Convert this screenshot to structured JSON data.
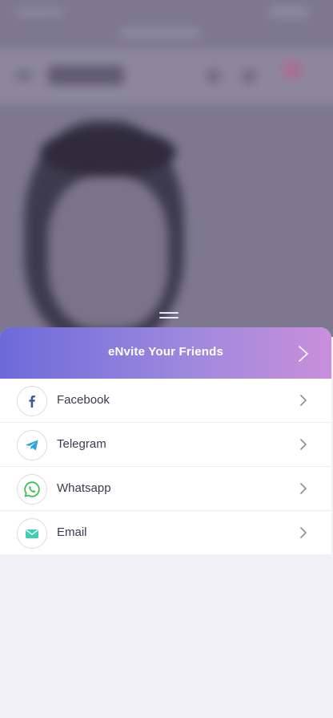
{
  "sheet": {
    "title": "eNvite Your Friends",
    "items": [
      {
        "label": "Facebook",
        "icon": "facebook-icon",
        "color": "#3b5998"
      },
      {
        "label": "Telegram",
        "icon": "telegram-icon",
        "color": "#2ea6d9"
      },
      {
        "label": "Whatsapp",
        "icon": "whatsapp-icon",
        "color": "#3cc153"
      },
      {
        "label": "Email",
        "icon": "email-icon",
        "color": "#3fd0b4"
      }
    ]
  },
  "colors": {
    "header_gradient_start": "#6c6ad9",
    "header_gradient_end": "#c98fdc",
    "sheet_background": "#f2f1f7"
  }
}
